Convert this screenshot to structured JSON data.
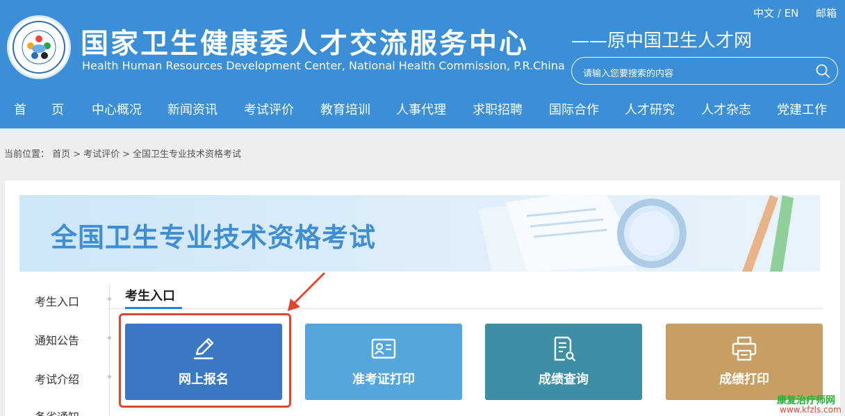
{
  "colors": {
    "header_bg": "#3a8fd6",
    "tile_register": "#3b78c4",
    "tile_admission": "#56a6de",
    "tile_score_query": "#3d8fa6",
    "tile_score_print": "#c79f63",
    "annotation": "#e2452e",
    "banner_title": "#3f8ed4"
  },
  "header": {
    "title_cn": "国家卫生健康委人才交流服务中心",
    "title_en": "Health Human Resources Development Center, National Health Commission, P.R.China",
    "subtitle": "——原中国卫生人才网",
    "lang": "中文 / EN",
    "mail": "邮箱",
    "search": {
      "placeholder": "请输入您要搜索的内容",
      "icon": "search-icon"
    },
    "logo_icon": "org-seal-logo"
  },
  "nav": [
    "首　　页",
    "中心概况",
    "新闻资讯",
    "考试评价",
    "教育培训",
    "人事代理",
    "求职招聘",
    "国际合作",
    "人才研究",
    "人才杂志",
    "党建工作"
  ],
  "breadcrumb": {
    "prefix": "当前位置：",
    "items": [
      "首页",
      "考试评价",
      "全国卫生专业技术资格考试"
    ],
    "separator": ">"
  },
  "banner": {
    "title": "全国卫生专业技术资格考试"
  },
  "sidebar": [
    "考生入口",
    "通知公告",
    "考试介绍",
    "备省通知"
  ],
  "tab": {
    "title": "考生入口"
  },
  "tiles": [
    {
      "label": "网上报名",
      "icon": "pencil-edit-icon"
    },
    {
      "label": "准考证打印",
      "icon": "id-card-icon"
    },
    {
      "label": "成绩查询",
      "icon": "document-search-icon"
    },
    {
      "label": "成绩打印",
      "icon": "printer-icon"
    }
  ],
  "watermark": {
    "line1": "康复治疗师网",
    "line2": "www.kfzls.com"
  }
}
